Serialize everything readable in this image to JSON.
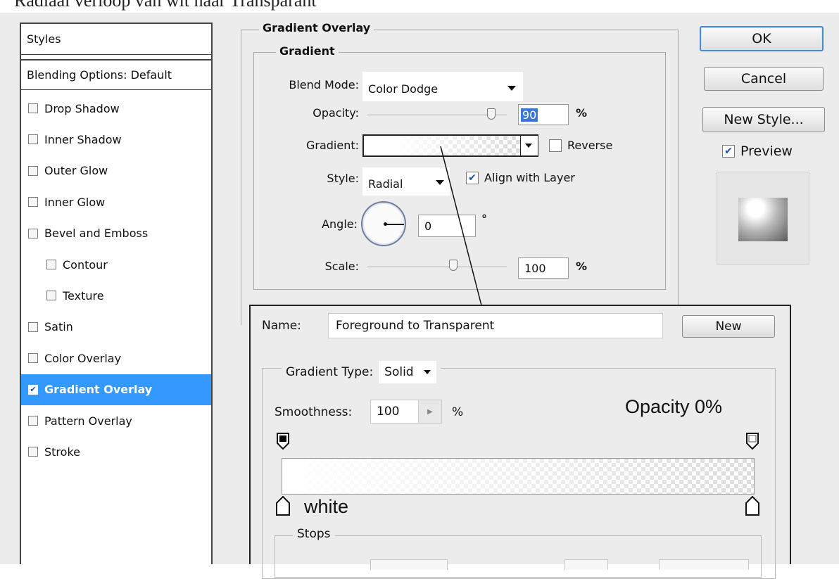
{
  "caption": "Radiaal verloop van wit naar Transparant",
  "styles_panel": {
    "header": "Styles",
    "blending": "Blending Options: Default",
    "items": [
      {
        "label": "Drop Shadow",
        "checked": false,
        "indent": false
      },
      {
        "label": "Inner Shadow",
        "checked": false,
        "indent": false
      },
      {
        "label": "Outer Glow",
        "checked": false,
        "indent": false
      },
      {
        "label": "Inner Glow",
        "checked": false,
        "indent": false
      },
      {
        "label": "Bevel and Emboss",
        "checked": false,
        "indent": false
      },
      {
        "label": "Contour",
        "checked": false,
        "indent": true
      },
      {
        "label": "Texture",
        "checked": false,
        "indent": true
      },
      {
        "label": "Satin",
        "checked": false,
        "indent": false
      },
      {
        "label": "Color Overlay",
        "checked": false,
        "indent": false
      },
      {
        "label": "Gradient Overlay",
        "checked": true,
        "indent": false,
        "selected": true
      },
      {
        "label": "Pattern Overlay",
        "checked": false,
        "indent": false
      },
      {
        "label": "Stroke",
        "checked": false,
        "indent": false
      }
    ]
  },
  "gradient_overlay": {
    "section_title": "Gradient Overlay",
    "group_title": "Gradient",
    "blend_mode_label": "Blend Mode:",
    "blend_mode_value": "Color Dodge",
    "opacity_label": "Opacity:",
    "opacity_value": "90",
    "opacity_unit": "%",
    "opacity_level": 0.9,
    "gradient_label": "Gradient:",
    "reverse_label": "Reverse",
    "reverse_checked": false,
    "style_label": "Style:",
    "style_value": "Radial",
    "align_label": "Align with Layer",
    "align_checked": true,
    "angle_label": "Angle:",
    "angle_value": "0",
    "angle_unit": "°",
    "scale_label": "Scale:",
    "scale_value": "100",
    "scale_unit": "%"
  },
  "buttons": {
    "ok": "OK",
    "cancel": "Cancel",
    "new_style": "New Style...",
    "preview_label": "Preview",
    "preview_checked": true
  },
  "gradient_editor": {
    "name_label": "Name:",
    "name_value": "Foreground to Transparent",
    "new_button": "New",
    "type_label": "Gradient Type:",
    "type_value": "Solid",
    "smoothness_label": "Smoothness:",
    "smoothness_value": "100",
    "smoothness_unit": "%",
    "stops_title": "Stops",
    "annotation_opacity": "Opacity 0%",
    "annotation_white": "white"
  },
  "colors": {
    "selection": "#3399ff",
    "dialog_bg": "#ececec",
    "ok_border": "#4a8bd0"
  }
}
